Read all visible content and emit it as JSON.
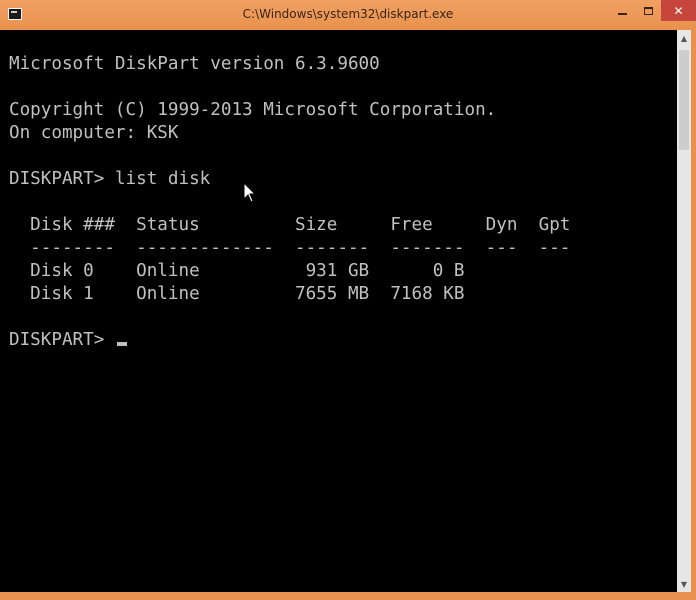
{
  "window": {
    "title": "C:\\Windows\\system32\\diskpart.exe",
    "controls": {
      "minimize": "minimize",
      "maximize": "maximize",
      "close": "✕"
    }
  },
  "console": {
    "lines": [
      "",
      "Microsoft DiskPart version 6.3.9600",
      "",
      "Copyright (C) 1999-2013 Microsoft Corporation.",
      "On computer: KSK",
      "",
      "DISKPART> list disk",
      "",
      "  Disk ###  Status         Size     Free     Dyn  Gpt",
      "  --------  -------------  -------  -------  ---  ---",
      "  Disk 0    Online          931 GB      0 B",
      "  Disk 1    Online         7655 MB  7168 KB",
      ""
    ],
    "prompt": "DISKPART> "
  },
  "icons": {
    "app": "console-app-icon",
    "pointer": "mouse-pointer-icon"
  }
}
